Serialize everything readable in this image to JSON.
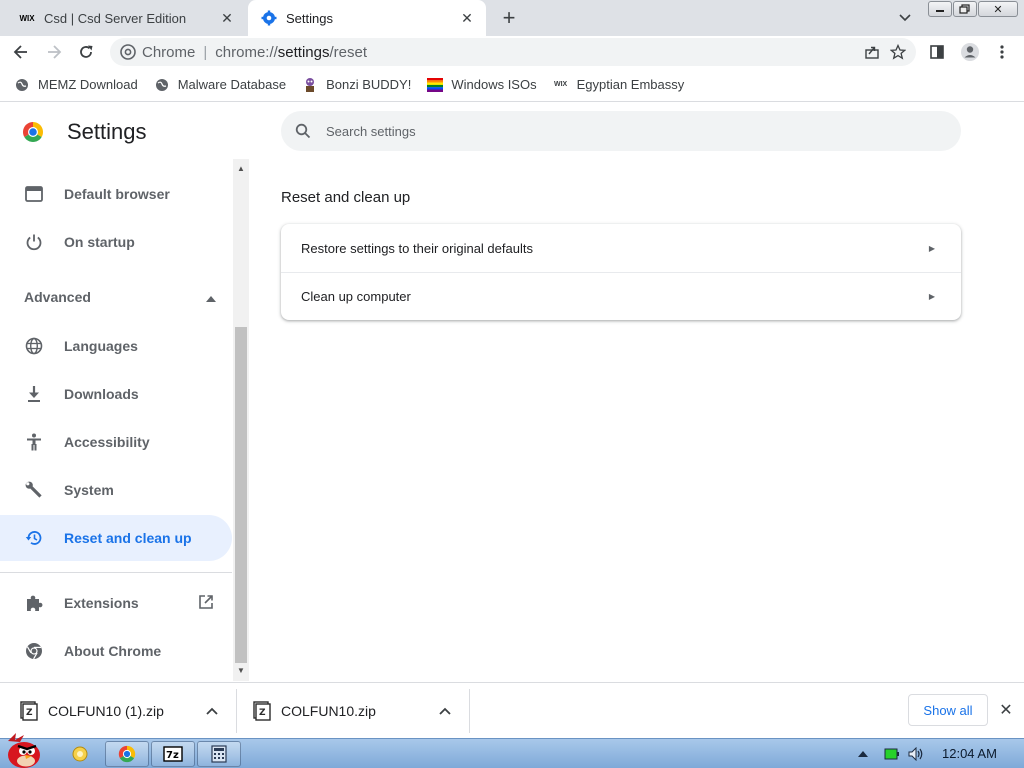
{
  "tabs": [
    {
      "title": "Csd | Csd Server Edition",
      "favicon": "wix-icon",
      "active": false
    },
    {
      "title": "Settings",
      "favicon": "settings-gear-icon",
      "active": true
    }
  ],
  "window_controls": {
    "minimize": "minimize-icon",
    "restore": "restore-icon",
    "close": "close-icon"
  },
  "omnibox": {
    "scheme_label": "Chrome",
    "separator": "|",
    "url_host": "chrome://",
    "url_path": "settings",
    "url_rest": "/reset"
  },
  "bookmarks": [
    {
      "label": "MEMZ Download",
      "icon": "globe-icon"
    },
    {
      "label": "Malware Database",
      "icon": "globe-icon"
    },
    {
      "label": "Bonzi BUDDY!",
      "icon": "bonzi-icon"
    },
    {
      "label": "Windows ISOs",
      "icon": "rainbow-flag-icon"
    },
    {
      "label": "Egyptian Embassy",
      "icon": "wix-icon"
    }
  ],
  "settings": {
    "title": "Settings",
    "search_placeholder": "Search settings",
    "nav": {
      "default_browser": "Default browser",
      "on_startup": "On startup",
      "advanced": "Advanced",
      "languages": "Languages",
      "downloads": "Downloads",
      "accessibility": "Accessibility",
      "system": "System",
      "reset": "Reset and clean up",
      "extensions": "Extensions",
      "about": "About Chrome"
    },
    "selected_nav": "Reset and clean up",
    "section_title": "Reset and clean up",
    "rows": [
      "Restore settings to their original defaults",
      "Clean up computer"
    ]
  },
  "downloads": {
    "items": [
      "COLFUN10 (1).zip",
      "COLFUN10.zip"
    ],
    "show_all": "Show all"
  },
  "taskbar": {
    "clock": "12:04 AM",
    "apps": [
      "folder-icon",
      "chrome-icon",
      "7zip-icon",
      "calculator-icon"
    ]
  },
  "colors": {
    "accent": "#1a73e8",
    "selected_bg": "#e8f0fe",
    "tabstrip": "#dee1e6"
  }
}
